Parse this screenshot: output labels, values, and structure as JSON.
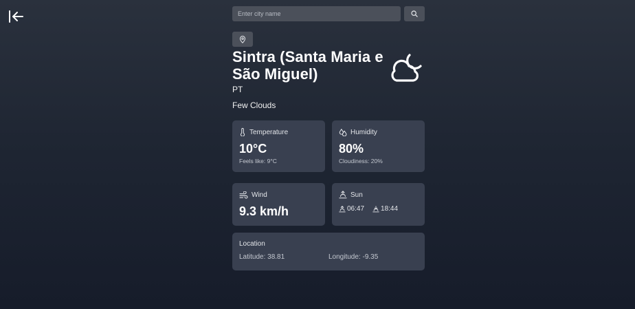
{
  "search": {
    "placeholder": "Enter city name"
  },
  "city": {
    "name": "Sintra (Santa Maria e São Miguel)",
    "country": "PT",
    "description": "Few Clouds"
  },
  "cards": {
    "temperature": {
      "title": "Temperature",
      "value": "10°C",
      "feels_like": "Feels like: 9°C"
    },
    "humidity": {
      "title": "Humidity",
      "value": "80%",
      "cloudiness": "Cloudiness: 20%"
    },
    "wind": {
      "title": "Wind",
      "value": "9.3 km/h"
    },
    "sun": {
      "title": "Sun",
      "sunrise": "06:47",
      "sunset": "18:44"
    }
  },
  "location": {
    "title": "Location",
    "latitude": "Latitude: 38.81",
    "longitude": "Longitude: -9.35"
  },
  "icons": {
    "back": "arrow-left-to-line-icon",
    "search": "search-icon",
    "locate": "map-pin-icon",
    "weather": "cloud-moon-icon",
    "temperature": "thermometer-icon",
    "humidity": "droplets-icon",
    "wind": "wind-icon",
    "sun": "sunrise-icon"
  },
  "colors": {
    "card": "#394050",
    "control": "#4b505a",
    "text": "#ffffff"
  }
}
